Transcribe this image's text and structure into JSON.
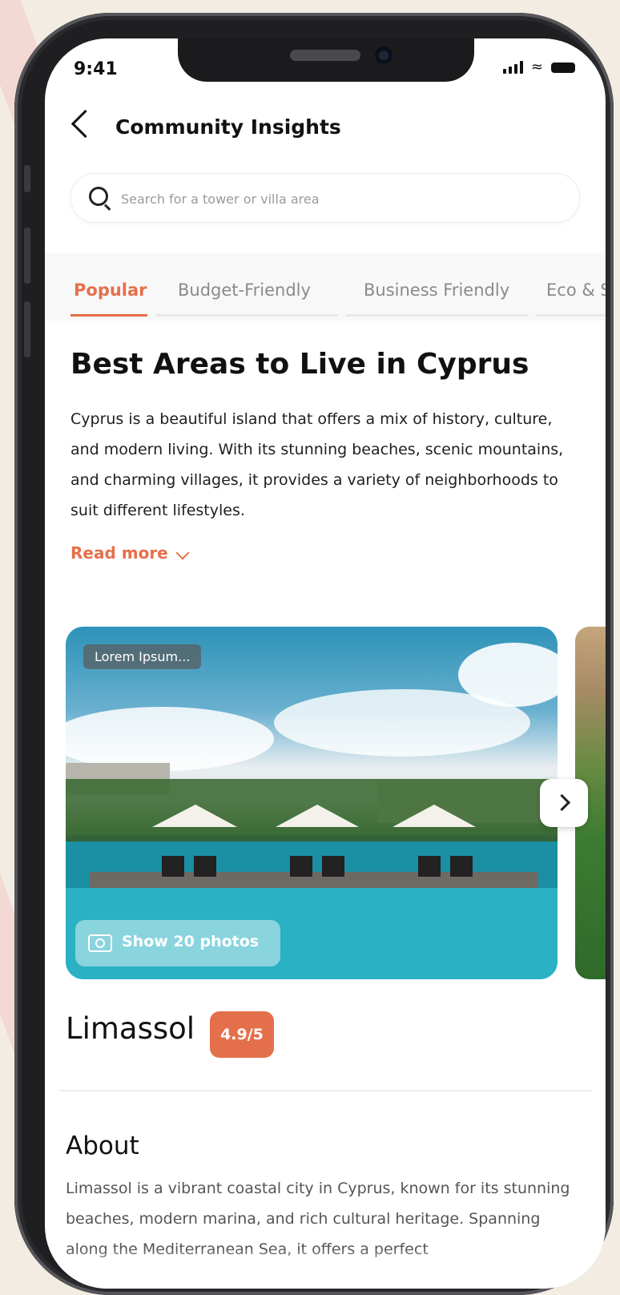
{
  "status_bar": {
    "time": "9:41"
  },
  "header": {
    "title": "Community Insights"
  },
  "search": {
    "placeholder": "Search for a tower or villa area"
  },
  "tabs": [
    {
      "label": "Popular",
      "active": true
    },
    {
      "label": "Budget-Friendly",
      "active": false
    },
    {
      "label": "Business Friendly",
      "active": false
    },
    {
      "label": "Eco & S",
      "active": false
    }
  ],
  "article": {
    "title": "Best Areas to Live in Cyprus",
    "intro": "Cyprus is a beautiful island that offers a mix of history, culture, and modern living. With its stunning beaches, scenic mountains, and charming villages, it provides a variety of neighborhoods to suit different lifestyles.",
    "read_more": "Read more"
  },
  "area_card": {
    "tag": "Lorem Ipsum...",
    "photos_button": "Show 20 photos"
  },
  "area": {
    "name": "Limassol",
    "rating": "4.9/5",
    "about_title": "About",
    "about_text": "Limassol is a vibrant coastal city in Cyprus, known for its stunning beaches, modern marina, and rich cultural heritage. Spanning along the Mediterranean Sea, it offers a perfect"
  },
  "colors": {
    "accent": "#e4704b",
    "text": "#111111",
    "muted": "#8a8a8a"
  },
  "icons": [
    "back-icon",
    "search-icon",
    "chevron-down-icon",
    "camera-icon",
    "chevron-right-icon",
    "signal-icon",
    "wifi-icon",
    "battery-icon"
  ]
}
